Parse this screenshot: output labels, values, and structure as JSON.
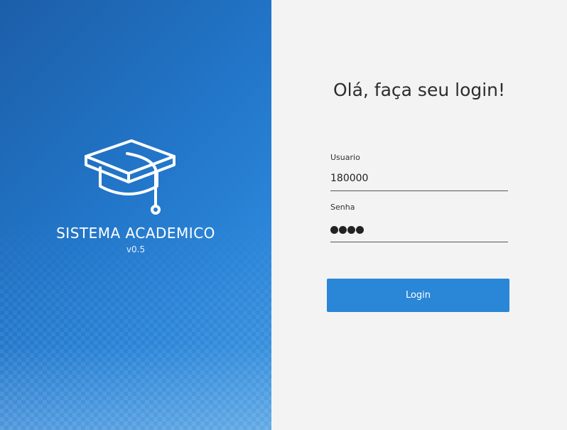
{
  "brand": {
    "logo_icon": "graduation-cap-icon",
    "title": "SISTEMA ACADEMICO",
    "version": "v0.5"
  },
  "login": {
    "greeting": "Olá, faça seu login!",
    "username_label": "Usuario",
    "username_value": "180000",
    "password_label": "Senha",
    "password_length": 4,
    "button_label": "Login"
  },
  "colors": {
    "primary": "#2a86d6",
    "left_panel": "#2276c9",
    "right_panel": "#f3f3f3"
  }
}
